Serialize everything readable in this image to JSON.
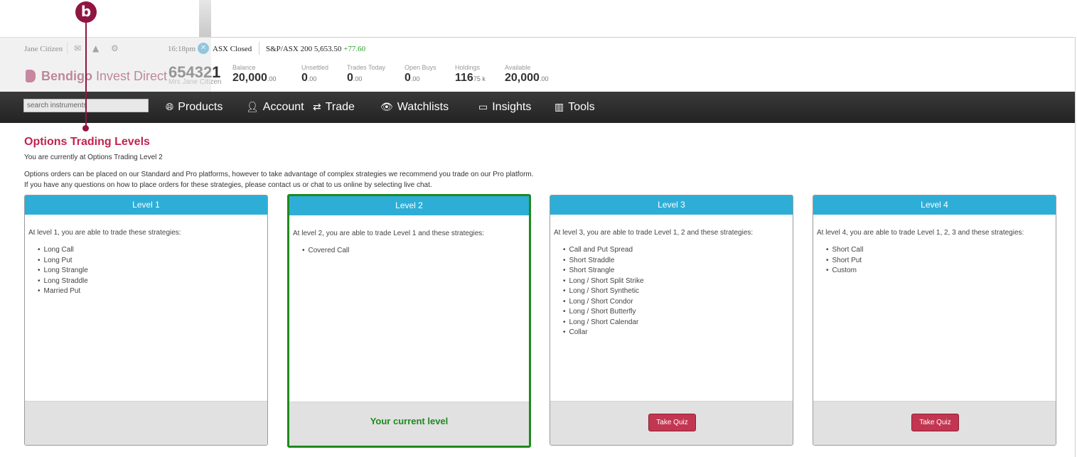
{
  "topbar": {
    "user": "Jane Citizen",
    "time": "16:18pm",
    "market_status": "ASX Closed",
    "index_name": "S&P/ASX 200",
    "index_value": "5,653.50",
    "index_change": "+77.60"
  },
  "header": {
    "brand_bold": "Bendigo",
    "brand_rest": " Invest Direct",
    "account_number": "654321",
    "account_name": "Mrs Jane Citizen",
    "stats": [
      {
        "label": "Balance",
        "value": "20,000",
        "small": ".00"
      },
      {
        "label": "Unsettled",
        "value": "0",
        "small": ".00"
      },
      {
        "label": "Trades Today",
        "value": "0",
        "small": ".00"
      },
      {
        "label": "Open Buys",
        "value": "0",
        "small": ".00"
      },
      {
        "label": "Holdings",
        "value": "116",
        "small": "75 k"
      },
      {
        "label": "Available",
        "value": "20,000",
        "small": ".00"
      }
    ]
  },
  "nav": {
    "search_placeholder": "search instruments",
    "items": [
      {
        "label": "Products"
      },
      {
        "label": "Account"
      },
      {
        "label": "Trade"
      },
      {
        "label": "Watchlists"
      },
      {
        "label": "Insights"
      },
      {
        "label": "Tools"
      }
    ]
  },
  "content": {
    "title": "Options Trading Levels",
    "current_note": "You are currently at Options Trading Level 2",
    "para1": "Options orders can be placed on our Standard and Pro platforms, however to take advantage of complex strategies we recommend you trade on our Pro platform.",
    "para2": "If you have any questions on how to place orders for these strategies, please contact us or chat to us online by selecting live chat."
  },
  "levels": [
    {
      "title": "Level 1",
      "intro": "At level 1, you are able to trade these strategies:",
      "items": [
        "Long Call",
        "Long Put",
        "Long Strangle",
        "Long Straddle",
        "Married Put"
      ],
      "footer": ""
    },
    {
      "title": "Level 2",
      "intro": "At level 2, you are able to trade Level 1 and these strategies:",
      "items": [
        "Covered Call"
      ],
      "footer": "Your current level"
    },
    {
      "title": "Level 3",
      "intro": "At level 3, you are able to trade Level 1, 2 and these strategies:",
      "items": [
        "Call and Put Spread",
        "Short Straddle",
        "Short Strangle",
        "Long / Short Split Strike",
        "Long / Short Synthetic",
        "Long / Short Condor",
        "Long / Short Butterfly",
        "Long / Short Calendar",
        "Collar"
      ],
      "footer": "Take Quiz"
    },
    {
      "title": "Level 4",
      "intro": "At level 4, you are able to trade Level 1, 2, 3 and these strategies:",
      "items": [
        "Short Call",
        "Short Put",
        "Custom"
      ],
      "footer": "Take Quiz"
    }
  ],
  "annotation": {
    "marker": "b"
  },
  "colors": {
    "brand": "#8e1641",
    "accent_blue": "#2eaed6",
    "current_green": "#1d8a1d",
    "title_red": "#c0244f"
  }
}
